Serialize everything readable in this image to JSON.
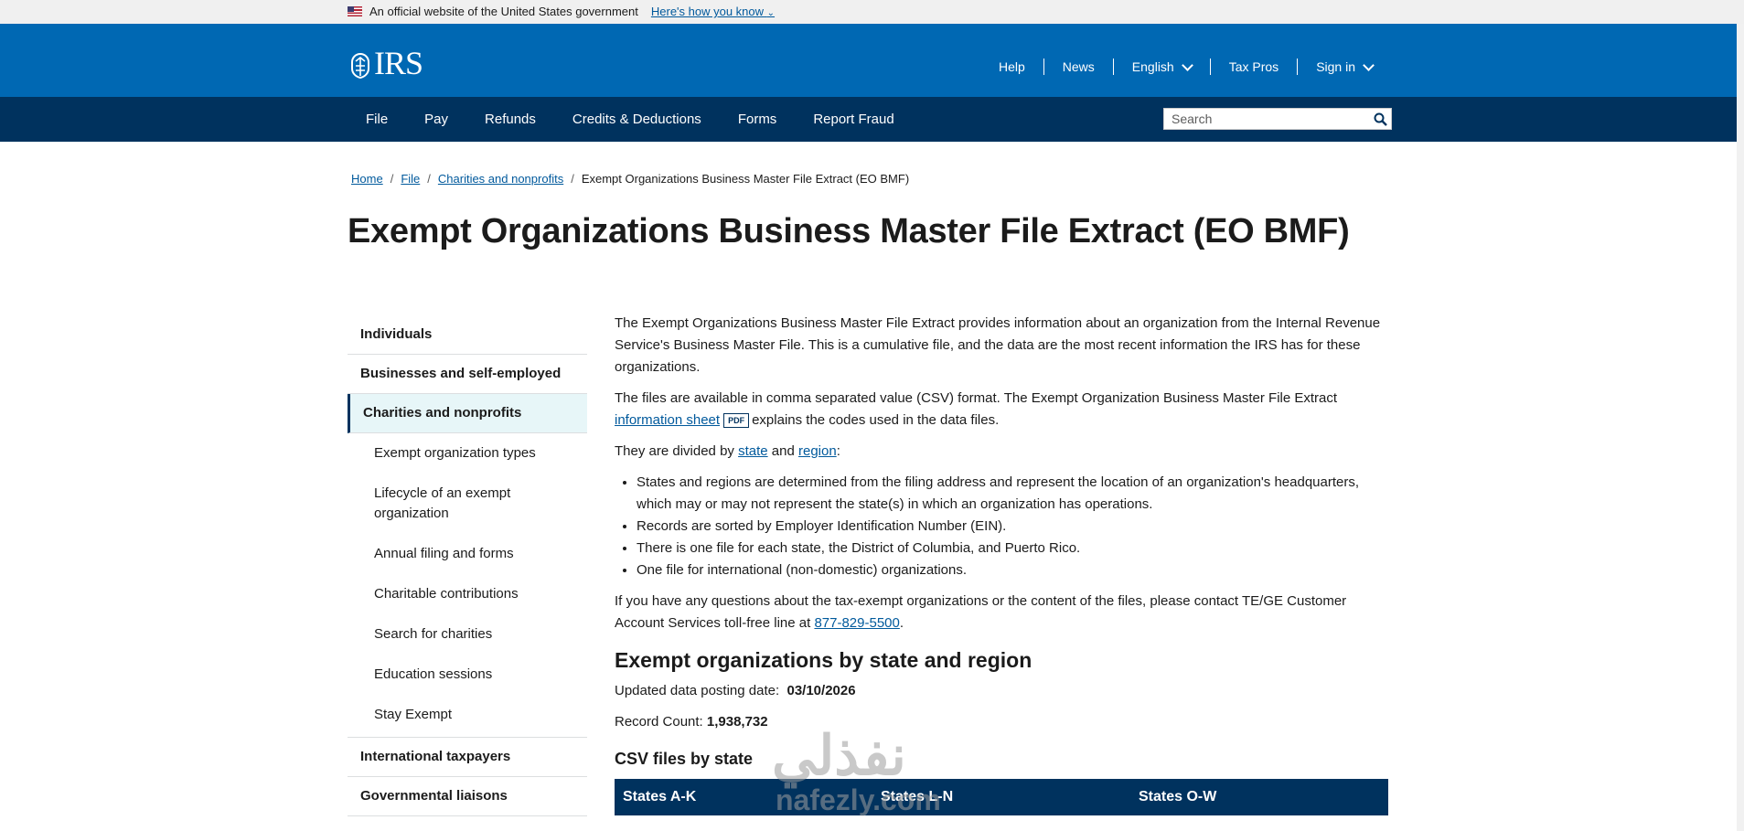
{
  "gov_banner": {
    "text": "An official website of the United States government",
    "link": "Here's how you know"
  },
  "header": {
    "logo_text": "IRS",
    "utility": [
      {
        "label": "Help"
      },
      {
        "label": "News"
      },
      {
        "label": "English"
      },
      {
        "label": "Tax Pros"
      },
      {
        "label": "Sign in"
      }
    ]
  },
  "nav": {
    "items": [
      "File",
      "Pay",
      "Refunds",
      "Credits & Deductions",
      "Forms",
      "Report Fraud"
    ],
    "search_placeholder": "Search"
  },
  "breadcrumb": [
    "Home",
    "File",
    "Charities and nonprofits",
    "Exempt Organizations Business Master File Extract (EO BMF)"
  ],
  "page_title": "Exempt Organizations Business Master File Extract (EO BMF)",
  "sidenav": {
    "top_items": [
      "Individuals",
      "Businesses and self-employed"
    ],
    "active": "Charities and nonprofits",
    "sub_items": [
      "Exempt organization types",
      "Lifecycle of an exempt organization",
      "Annual filing and forms",
      "Charitable contributions",
      "Search for charities",
      "Education sessions",
      "Stay Exempt"
    ],
    "bottom_items": [
      "International taxpayers",
      "Governmental liaisons"
    ]
  },
  "content": {
    "p1": "The Exempt Organizations Business Master File Extract provides information about an organization from the Internal Revenue Service's Business Master File. This is a cumulative file, and the data are the most recent information the IRS has for these organizations.",
    "p2_before": "The files are available in comma separated value (CSV) format. The Exempt Organization Business Master File Extract",
    "p2_link": "information sheet",
    "p2_badge": "PDF",
    "p2_after": "explains the codes used in the data files.",
    "p3_before": "They are divided by",
    "p3_link1": "state",
    "p3_mid": "and",
    "p3_link2": "region",
    "p3_after": ":",
    "bullets": [
      "States and regions are determined from the filing address and represent the location of an organization's headquarters, which may or may not represent the state(s) in which an organization has operations.",
      "Records are sorted by Employer Identification Number (EIN).",
      "There is one file for each state, the District of Columbia, and Puerto Rico.",
      "One file for international (non-domestic) organizations."
    ],
    "p4_before": "If you have any questions about the tax-exempt organizations or the content of the files, please contact TE/GE Customer Account Services toll-free line at",
    "p4_phone": "877-829-5500",
    "p4_after": ".",
    "h2": "Exempt organizations by state and region",
    "updated_label": "Updated data posting date:",
    "updated_value": "03/10/2026",
    "record_label": "Record Count:",
    "record_value": "1,938,732",
    "h3": "CSV files by state",
    "table_headers": [
      "States A-K",
      "States L-N",
      "States O-W"
    ]
  },
  "watermark": {
    "arabic": "نفذلي",
    "latin": "nafezly.com"
  },
  "colors": {
    "header_blue": "#0068b3",
    "nav_navy": "#00325e",
    "link": "#00599c",
    "active_bg": "#e7f6f8"
  }
}
